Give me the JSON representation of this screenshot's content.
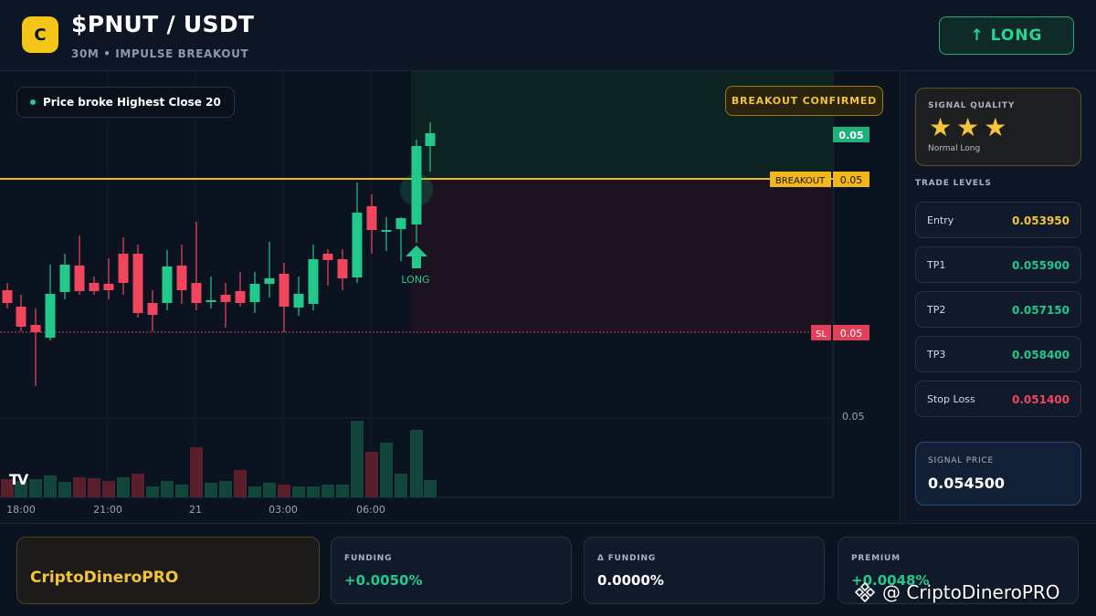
{
  "header": {
    "logo_letter": "C",
    "title": "$PNUT / USDT",
    "subtitle": "30M • IMPULSE BREAKOUT",
    "long_button": "↑ LONG"
  },
  "chart": {
    "callout_text": "Price broke Highest Close 20",
    "breakout_badge": "BREAKOUT CONFIRMED",
    "breakout_label": "BREAKOUT",
    "sl_label": "SL",
    "long_marker_text": "LONG",
    "price_tags": {
      "top": "0.05",
      "breakout": "0.05",
      "sl": "0.05",
      "axis": "0.05"
    },
    "time_labels": [
      "18:00",
      "21:00",
      "21",
      "03:00",
      "06:00"
    ],
    "tv_logo": "TV",
    "colors": {
      "up": "#22c98a",
      "down": "#f0455a",
      "breakout_line": "#f2b71a",
      "sl_line": "#d93e50"
    }
  },
  "sidebar": {
    "quality_label": "SIGNAL QUALITY",
    "quality_stars": 3,
    "quality_note": "Normal Long",
    "levels_title": "TRADE LEVELS",
    "levels": [
      {
        "name": "Entry",
        "value": "0.053950",
        "color": "#f2c43a"
      },
      {
        "name": "TP1",
        "value": "0.055900",
        "color": "#22c98a"
      },
      {
        "name": "TP2",
        "value": "0.057150",
        "color": "#22c98a"
      },
      {
        "name": "TP3",
        "value": "0.058400",
        "color": "#22c98a"
      },
      {
        "name": "Stop Loss",
        "value": "0.051400",
        "color": "#f0455a"
      }
    ],
    "signal_label": "SIGNAL PRICE",
    "signal_value": "0.054500"
  },
  "footer": {
    "brand": "CriptoDineroPRO",
    "stats": [
      {
        "label": "FUNDING",
        "value": "+0.0050%",
        "color": "#22c98a"
      },
      {
        "label": "Δ FUNDING",
        "value": "0.0000%",
        "color": "#ffffff"
      },
      {
        "label": "PREMIUM",
        "value": "+0.0048%",
        "color": "#22c98a"
      }
    ],
    "watermark": "@ CriptoDineroPRO"
  }
}
